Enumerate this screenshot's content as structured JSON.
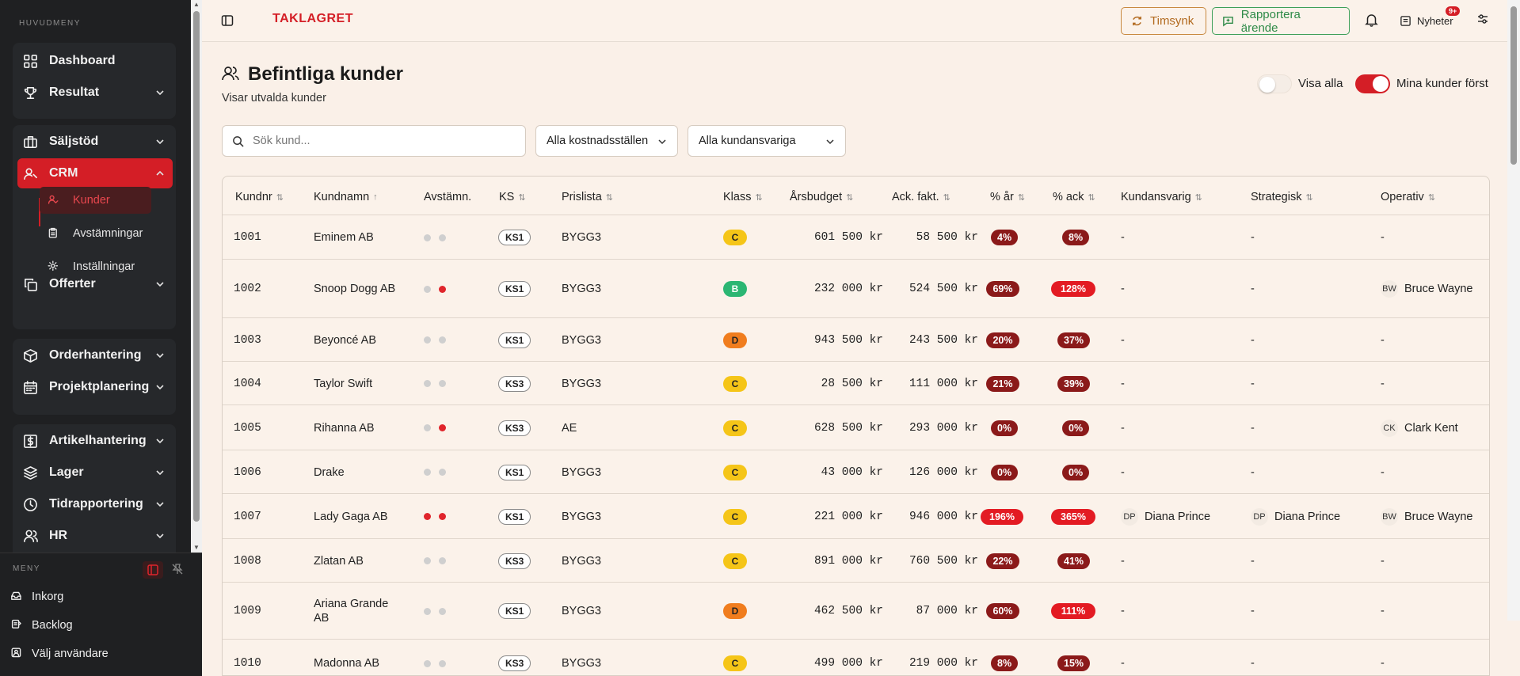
{
  "sidebar": {
    "heading": "HUVUDMENY",
    "items": [
      {
        "label": "Dashboard",
        "icon": "grid-icon"
      },
      {
        "label": "Resultat",
        "icon": "trophy-icon"
      },
      {
        "label": "Säljstöd",
        "icon": "briefcase-icon"
      },
      {
        "label": "CRM",
        "icon": "user-icon"
      },
      {
        "label": "Offerter",
        "icon": "copy-icon"
      },
      {
        "label": "Orderhantering",
        "icon": "box-icon"
      },
      {
        "label": "Projektplanering",
        "icon": "calendar-icon"
      },
      {
        "label": "Artikelhantering",
        "icon": "dollar-icon"
      },
      {
        "label": "Lager",
        "icon": "layers-icon"
      },
      {
        "label": "Tidrapportering",
        "icon": "clock-icon"
      },
      {
        "label": "HR",
        "icon": "users-icon"
      }
    ],
    "crm_sub": [
      {
        "label": "Kunder",
        "icon": "user-check-icon"
      },
      {
        "label": "Avstämningar",
        "icon": "clipboard-icon"
      },
      {
        "label": "Inställningar",
        "icon": "gear-icon"
      }
    ],
    "bottom": {
      "label": "MENY",
      "items": [
        {
          "label": "Inkorg",
          "icon": "inbox-icon"
        },
        {
          "label": "Backlog",
          "icon": "list-icon"
        },
        {
          "label": "Välj användare",
          "icon": "user-square-icon"
        }
      ]
    }
  },
  "topbar": {
    "logo": "TAKLAGRET",
    "timsynk": "Timsynk",
    "rapportera": "Rapportera ärende",
    "nyheter": "Nyheter",
    "nyheter_badge": "9+"
  },
  "page": {
    "title": "Befintliga kunder",
    "subtitle": "Visar utvalda kunder",
    "toggle_all": "Visa alla",
    "toggle_all_on": false,
    "toggle_mine": "Mina kunder först",
    "toggle_mine_on": true,
    "search_placeholder": "Sök kund...",
    "filter_cost": "Alla kostnadsställen",
    "filter_owner": "Alla kundansvariga"
  },
  "colors": {
    "accent": "#d41e26",
    "dark_red": "#8b1a1a",
    "bright_red": "#e31b23",
    "class_c": "#f5c518",
    "class_b": "#2bb673",
    "class_d": "#f07d1e",
    "dot_gray": "#cfcfcf",
    "dot_red": "#e0252c"
  },
  "table": {
    "headers": [
      "Kundnr",
      "Kundnamn",
      "Avstämn.",
      "KS",
      "Prislista",
      "Klass",
      "Årsbudget",
      "Ack. fakt.",
      "% år",
      "% ack",
      "Kundansvarig",
      "Strategisk",
      "Operativ"
    ],
    "rows": [
      {
        "nr": "1001",
        "name": "Eminem AB",
        "dots": [
          "gray",
          "gray"
        ],
        "ks": "KS1",
        "pris": "BYGG3",
        "klass": "C",
        "budget": "601 500 kr",
        "ack": "58 500 kr",
        "par": "4%",
        "par_hi": false,
        "pack": "8%",
        "pack_hi": false,
        "ka": "-",
        "ka_init": "",
        "str": "-",
        "str_init": "",
        "op": "-",
        "op_init": ""
      },
      {
        "nr": "1002",
        "name": "Snoop Dogg AB",
        "dots": [
          "gray",
          "red"
        ],
        "ks": "KS1",
        "pris": "BYGG3",
        "klass": "B",
        "budget": "232 000 kr",
        "ack": "524 500 kr",
        "par": "69%",
        "par_hi": false,
        "pack": "128%",
        "pack_hi": true,
        "ka": "-",
        "ka_init": "",
        "str": "-",
        "str_init": "",
        "op": "Bruce Wayne",
        "op_init": "BW"
      },
      {
        "nr": "1003",
        "name": "Beyoncé AB",
        "dots": [
          "gray",
          "gray"
        ],
        "ks": "KS1",
        "pris": "BYGG3",
        "klass": "D",
        "budget": "943 500 kr",
        "ack": "243 500 kr",
        "par": "20%",
        "par_hi": false,
        "pack": "37%",
        "pack_hi": false,
        "ka": "-",
        "ka_init": "",
        "str": "-",
        "str_init": "",
        "op": "-",
        "op_init": ""
      },
      {
        "nr": "1004",
        "name": "Taylor Swift",
        "dots": [
          "gray",
          "gray"
        ],
        "ks": "KS3",
        "pris": "BYGG3",
        "klass": "C",
        "budget": "28 500 kr",
        "ack": "111 000 kr",
        "par": "21%",
        "par_hi": false,
        "pack": "39%",
        "pack_hi": false,
        "ka": "-",
        "ka_init": "",
        "str": "-",
        "str_init": "",
        "op": "-",
        "op_init": ""
      },
      {
        "nr": "1005",
        "name": "Rihanna AB",
        "dots": [
          "gray",
          "red"
        ],
        "ks": "KS3",
        "pris": "AE",
        "klass": "C",
        "budget": "628 500 kr",
        "ack": "293 000 kr",
        "par": "0%",
        "par_hi": false,
        "pack": "0%",
        "pack_hi": false,
        "ka": "-",
        "ka_init": "",
        "str": "-",
        "str_init": "",
        "op": "Clark Kent",
        "op_init": "CK"
      },
      {
        "nr": "1006",
        "name": "Drake",
        "dots": [
          "gray",
          "gray"
        ],
        "ks": "KS1",
        "pris": "BYGG3",
        "klass": "C",
        "budget": "43 000 kr",
        "ack": "126 000 kr",
        "par": "0%",
        "par_hi": false,
        "pack": "0%",
        "pack_hi": false,
        "ka": "-",
        "ka_init": "",
        "str": "-",
        "str_init": "",
        "op": "-",
        "op_init": ""
      },
      {
        "nr": "1007",
        "name": "Lady Gaga AB",
        "dots": [
          "red",
          "red"
        ],
        "ks": "KS1",
        "pris": "BYGG3",
        "klass": "C",
        "budget": "221 000 kr",
        "ack": "946 000 kr",
        "par": "196%",
        "par_hi": true,
        "pack": "365%",
        "pack_hi": true,
        "ka": "Diana Prince",
        "ka_init": "DP",
        "str": "Diana Prince",
        "str_init": "DP",
        "op": "Bruce Wayne",
        "op_init": "BW"
      },
      {
        "nr": "1008",
        "name": "Zlatan AB",
        "dots": [
          "gray",
          "gray"
        ],
        "ks": "KS3",
        "pris": "BYGG3",
        "klass": "C",
        "budget": "891 000 kr",
        "ack": "760 500 kr",
        "par": "22%",
        "par_hi": false,
        "pack": "41%",
        "pack_hi": false,
        "ka": "-",
        "ka_init": "",
        "str": "-",
        "str_init": "",
        "op": "-",
        "op_init": ""
      },
      {
        "nr": "1009",
        "name": "Ariana Grande AB",
        "dots": [
          "gray",
          "gray"
        ],
        "ks": "KS1",
        "pris": "BYGG3",
        "klass": "D",
        "budget": "462 500 kr",
        "ack": "87 000 kr",
        "par": "60%",
        "par_hi": false,
        "pack": "111%",
        "pack_hi": true,
        "ka": "-",
        "ka_init": "",
        "str": "-",
        "str_init": "",
        "op": "-",
        "op_init": ""
      },
      {
        "nr": "1010",
        "name": "Madonna AB",
        "dots": [
          "gray",
          "gray"
        ],
        "ks": "KS3",
        "pris": "BYGG3",
        "klass": "C",
        "budget": "499 000 kr",
        "ack": "219 000 kr",
        "par": "8%",
        "par_hi": false,
        "pack": "15%",
        "pack_hi": false,
        "ka": "-",
        "ka_init": "",
        "str": "-",
        "str_init": "",
        "op": "-",
        "op_init": ""
      }
    ]
  }
}
